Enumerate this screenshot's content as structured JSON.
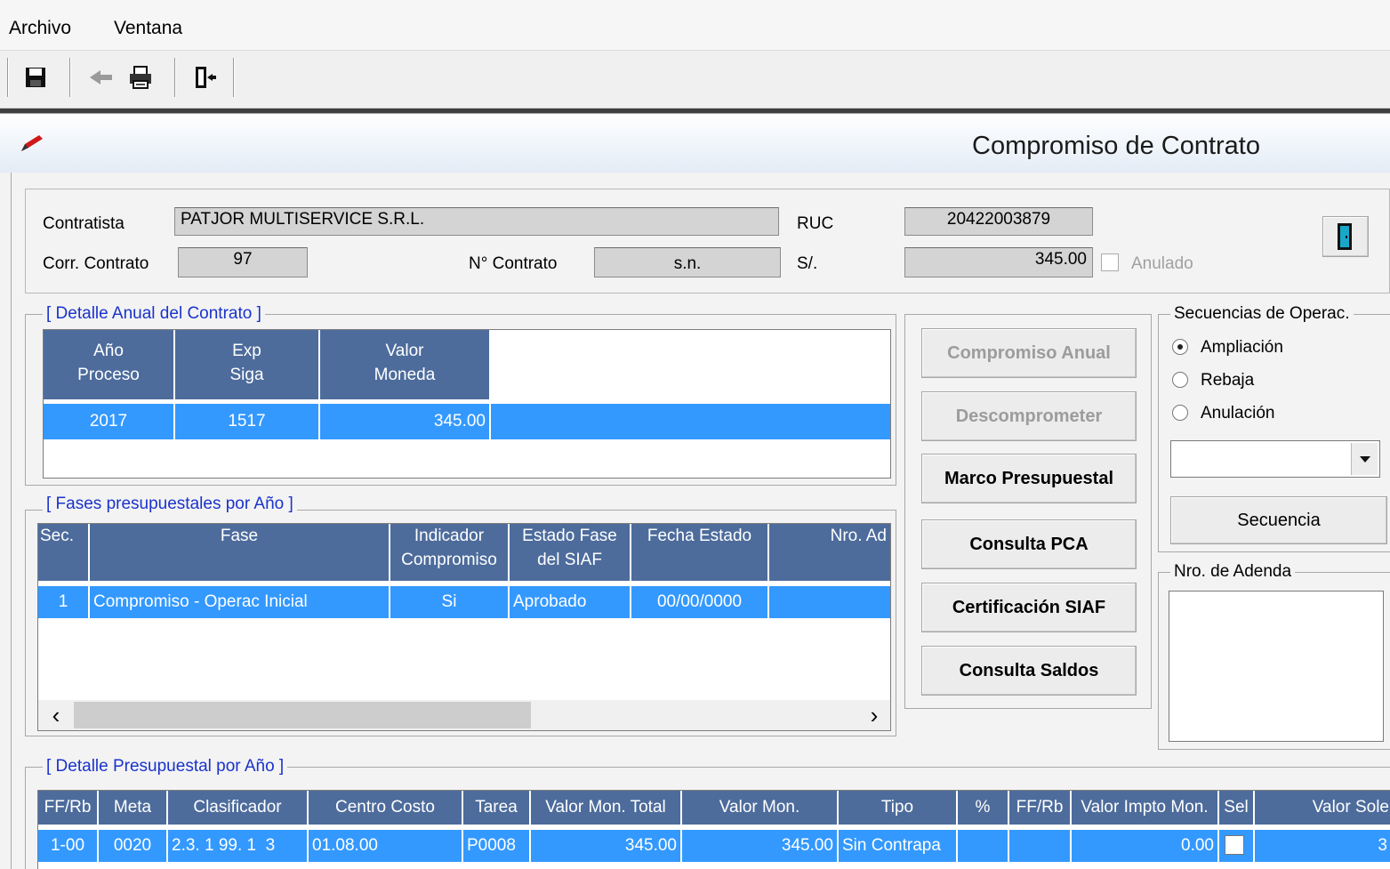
{
  "menu": {
    "items": [
      "Archivo",
      "Ventana"
    ]
  },
  "toolbar": {
    "buttons": [
      {
        "name": "save-icon",
        "label": ""
      },
      {
        "name": "back-icon",
        "label": ""
      },
      {
        "name": "print-icon",
        "label": ""
      },
      {
        "name": "exit-door-icon",
        "label": ""
      }
    ]
  },
  "window": {
    "title": "Compromiso de Contrato"
  },
  "header": {
    "contratista_label": "Contratista",
    "contratista_value": "PATJOR MULTISERVICE S.R.L.",
    "ruc_label": "RUC",
    "ruc_value": "20422003879",
    "corr_label": "Corr. Contrato",
    "corr_value": "97",
    "nro_contrato_label": "N° Contrato",
    "nro_contrato_value": "s.n.",
    "soles_label": "S/.",
    "soles_value": "345.00",
    "anulado_label": "Anulado"
  },
  "detalle_anual": {
    "title": "[ Detalle Anual del Contrato ]",
    "columns": [
      {
        "line1": "Año",
        "line2": "Proceso"
      },
      {
        "line1": "Exp",
        "line2": "Siga"
      },
      {
        "line1": "Valor",
        "line2": "Moneda"
      }
    ],
    "rows": [
      [
        "2017",
        "1517",
        "345.00"
      ]
    ]
  },
  "fases": {
    "title": "[ Fases presupuestales por Año ]",
    "columns": [
      {
        "line1": "Sec.",
        "line2": ""
      },
      {
        "line1": "Fase",
        "line2": ""
      },
      {
        "line1": "Indicador",
        "line2": "Compromiso"
      },
      {
        "line1": "Estado Fase",
        "line2": "del SIAF"
      },
      {
        "line1": "Fecha Estado",
        "line2": ""
      },
      {
        "line1": "Nro. Ad",
        "line2": ""
      }
    ],
    "rows": [
      [
        "1",
        "Compromiso - Operac Inicial",
        "Si",
        "Aprobado",
        "00/00/0000",
        ""
      ]
    ],
    "scroll_left": "‹",
    "scroll_right": "›"
  },
  "actions": {
    "compromiso_anual": "Compromiso Anual",
    "descomprometer": "Descomprometer",
    "marco_presupuestal": "Marco Presupuestal",
    "consulta_pca": "Consulta PCA",
    "certificacion_siaf": "Certificación SIAF",
    "consulta_saldos": "Consulta Saldos"
  },
  "secuencias": {
    "title": "Secuencias de Operac.",
    "options": [
      "Ampliación",
      "Rebaja",
      "Anulación"
    ],
    "selected": "Ampliación",
    "dropdown_value": "",
    "secuencia_button": "Secuencia"
  },
  "adenda": {
    "title": "Nro. de Adenda"
  },
  "detalle_presupuestal": {
    "title": "[ Detalle Presupuestal por Año ]",
    "columns": [
      "FF/Rb",
      "Meta",
      "Clasificador",
      "Centro Costo",
      "Tarea",
      "Valor Mon. Total",
      "Valor Mon.",
      "Tipo",
      "%",
      "FF/Rb",
      "Valor Impto Mon.",
      "Sel",
      "Valor Sole"
    ],
    "rows": [
      [
        "1-00",
        "0020",
        "2.3. 1 99. 1  3",
        "01.08.00",
        "P0008",
        "345.00",
        "345.00",
        "Sin Contrapa",
        "",
        "",
        "0.00",
        "",
        "3"
      ]
    ]
  }
}
